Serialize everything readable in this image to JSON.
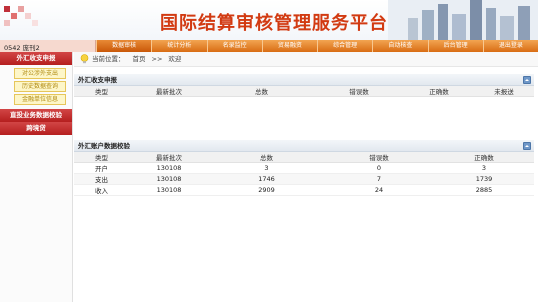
{
  "header": {
    "title": "国际结算审核管理服务平台"
  },
  "user": {
    "label": "0542 庞刊2"
  },
  "nav": {
    "items": [
      {
        "label": "数据审核"
      },
      {
        "label": "统计分析"
      },
      {
        "label": "名录监控"
      },
      {
        "label": "贸易融资"
      },
      {
        "label": "综合管理"
      },
      {
        "label": "自动核查"
      },
      {
        "label": "后台管理"
      },
      {
        "label": "退出登录"
      }
    ]
  },
  "sidebar": {
    "section1": "外汇收支申报",
    "subitems": [
      {
        "label": "对公涉外支出"
      },
      {
        "label": "历史数据查询"
      },
      {
        "label": "金融单位信息"
      }
    ],
    "section2": "直投业务数据校验",
    "section3": "跨境贷"
  },
  "breadcrumb": {
    "prefix": "当前位置：",
    "home": "首页",
    "sep": ">>",
    "current": "欢迎"
  },
  "panel1": {
    "title": "外汇收支申报",
    "headers": [
      "类型",
      "最新批次",
      "总数",
      "错误数",
      "正确数",
      "未报送"
    ]
  },
  "panel2": {
    "title": "外汇账户数据校验",
    "headers": [
      "类型",
      "最新批次",
      "总数",
      "错误数",
      "正确数"
    ],
    "rows": [
      [
        "开户",
        "130108",
        "3",
        "0",
        "3"
      ],
      [
        "支出",
        "130108",
        "1746",
        "7",
        "1739"
      ],
      [
        "收入",
        "130108",
        "2909",
        "24",
        "2885"
      ]
    ]
  }
}
